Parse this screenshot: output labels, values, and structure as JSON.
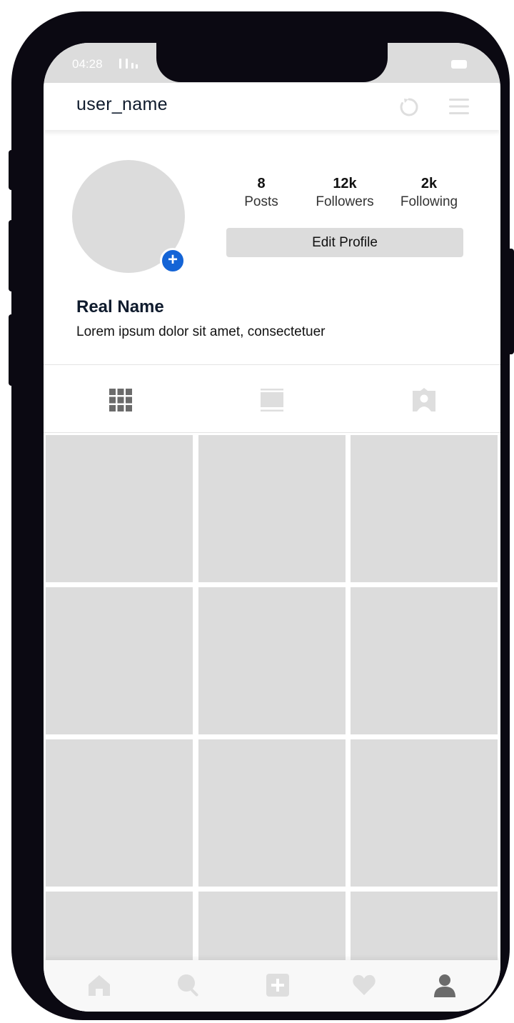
{
  "status_bar": {
    "time": "04:28"
  },
  "header": {
    "username": "user_name"
  },
  "profile": {
    "stats": [
      {
        "number": "8",
        "label": "Posts"
      },
      {
        "number": "12k",
        "label": "Followers"
      },
      {
        "number": "2k",
        "label": "Following"
      }
    ],
    "edit_button_label": "Edit Profile",
    "real_name": "Real Name",
    "bio": "Lorem ipsum dolor sit amet, consectetuer"
  },
  "tabs": [
    {
      "icon": "grid-icon",
      "active": true
    },
    {
      "icon": "feed-icon",
      "active": false
    },
    {
      "icon": "tagged-icon",
      "active": false
    }
  ],
  "grid": {
    "tile_count": 12
  },
  "bottom_nav": [
    {
      "icon": "home-icon",
      "active": false
    },
    {
      "icon": "search-icon",
      "active": false
    },
    {
      "icon": "add-post-icon",
      "active": false
    },
    {
      "icon": "heart-icon",
      "active": false
    },
    {
      "icon": "profile-icon",
      "active": true
    }
  ],
  "colors": {
    "frame": "#0b0912",
    "placeholder": "#dcdcdc",
    "accent": "#1464d6",
    "text_dark": "#0f1b2d",
    "icon_inactive": "#dedede",
    "icon_active": "#6b6b6b"
  }
}
